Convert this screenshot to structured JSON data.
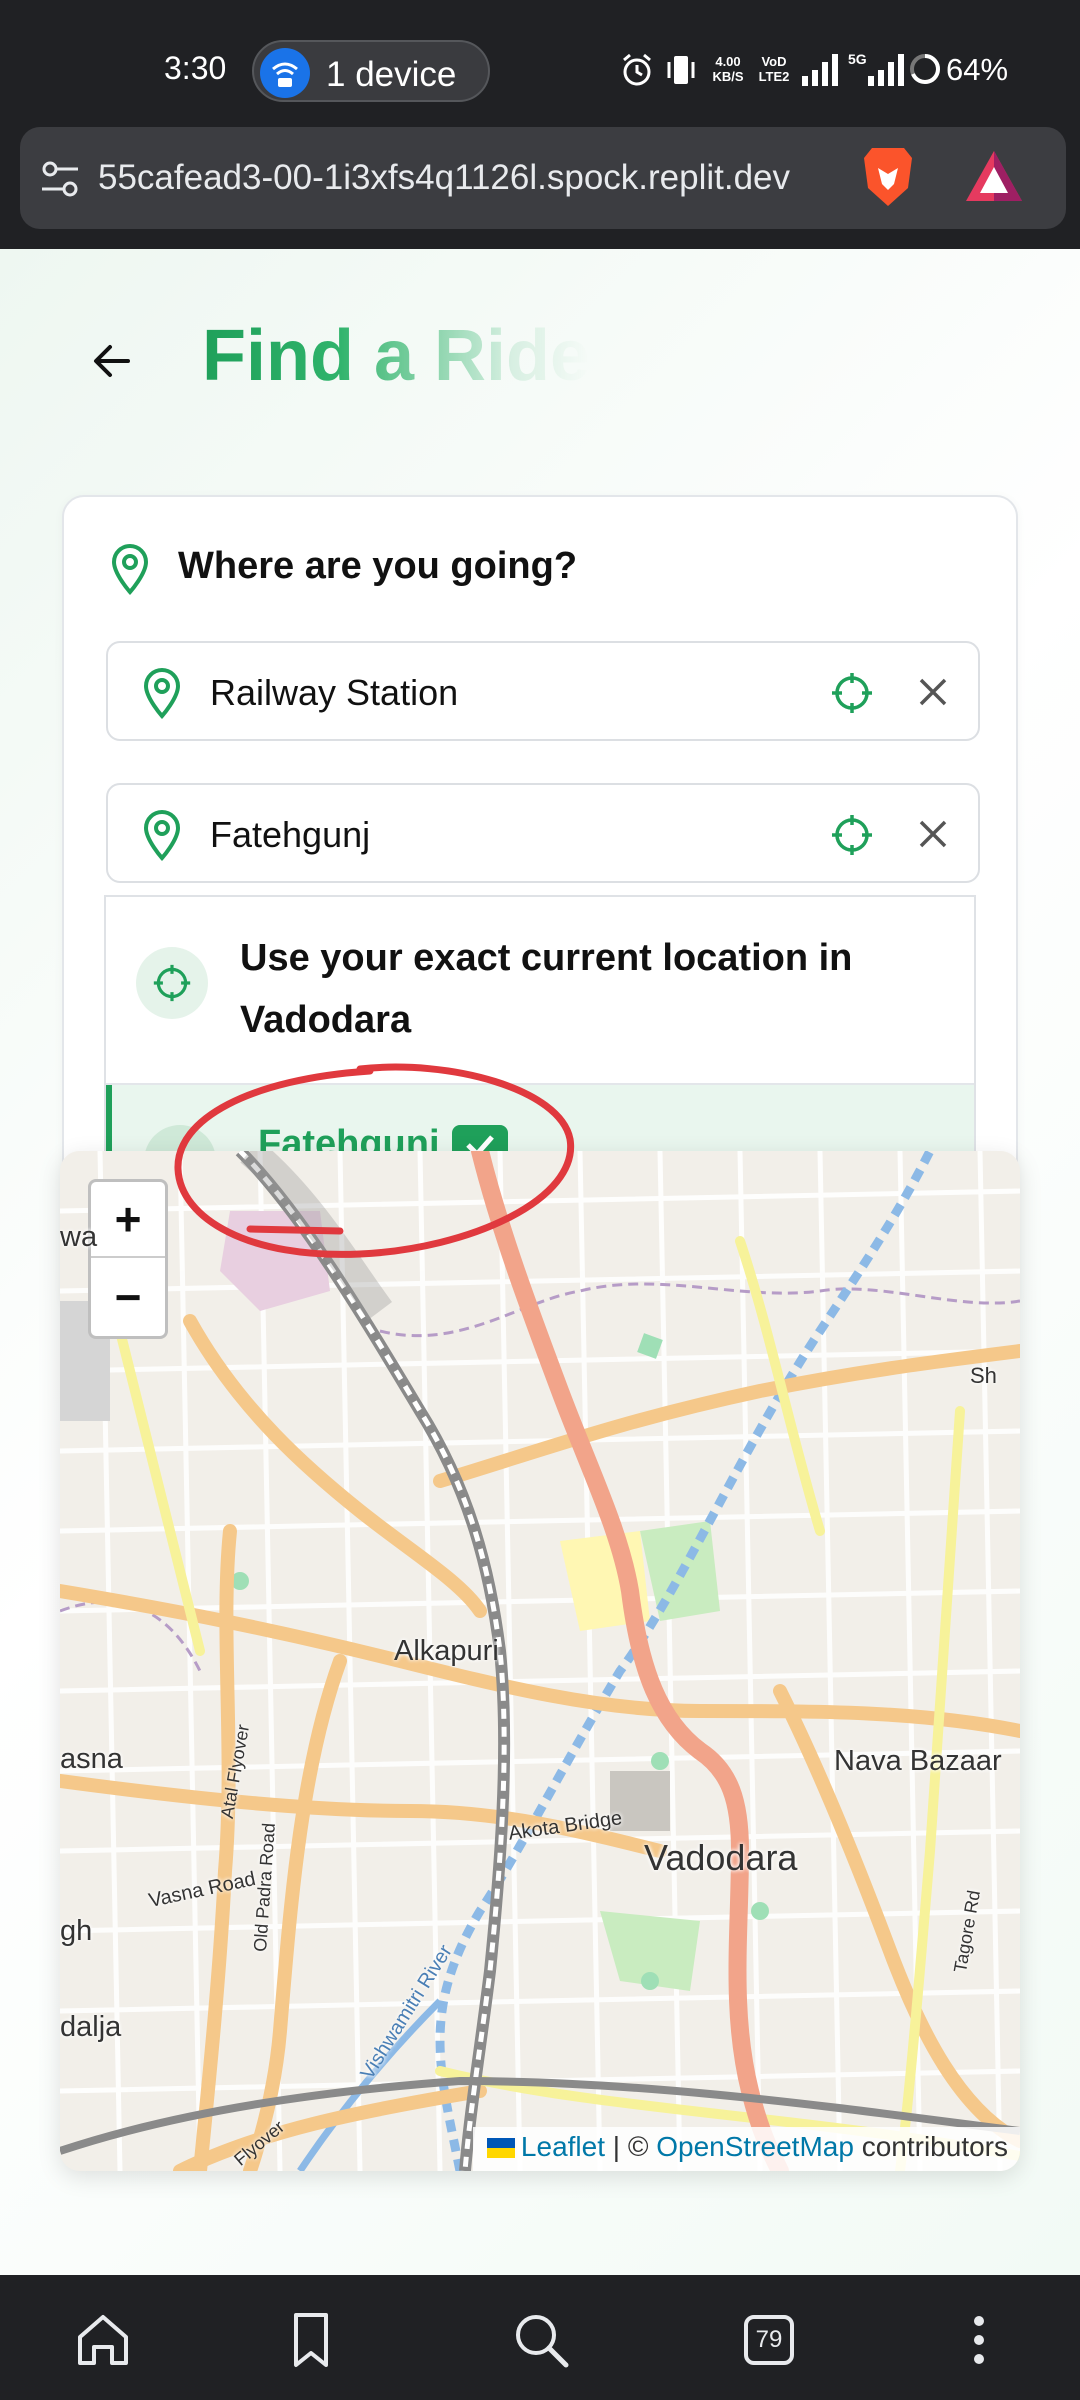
{
  "status_bar": {
    "time": "3:30",
    "cast_label": "1 device",
    "net_speed_value": "4.00",
    "net_speed_unit": "KB/S",
    "volte_top": "VoD",
    "volte_bottom": "LTE2",
    "network_badge": "5G",
    "battery": "64%"
  },
  "browser": {
    "url": "55cafead3-00-1i3xfs4q1126l.spock.replit.dev",
    "tab_count": "79"
  },
  "page": {
    "title": "Find a Ride"
  },
  "search": {
    "heading": "Where are you going?",
    "pickup_value": "Railway Station",
    "destination_value": "Fatehgunj"
  },
  "suggestions": {
    "current_location": "Use your exact current location in Vadodara",
    "match": "Fatehgunj",
    "match_badge": "✓"
  },
  "map": {
    "zoom_in": "+",
    "zoom_out": "−",
    "labels": {
      "alkapuri": "Alkapuri",
      "vadodara": "Vadodara",
      "nava_bazaar": "Nava Bazaar",
      "akota_bridge": "Akota Bridge",
      "vasna_road": "Vasna Road",
      "atal_flyover": "Atal Flyover",
      "old_padra_road": "Old Padra Road",
      "vishwamitri_river": "Vishwamitri River",
      "tagore_rd": "Tagore Rd",
      "edge_wa": "wa",
      "edge_asna": "asna",
      "edge_gh": "gh",
      "edge_dalja": "dalja",
      "edge_sh": "Sh",
      "edge_flyover": "Flyover"
    },
    "attribution": {
      "leaflet": "Leaflet",
      "separator": " | © ",
      "osm": "OpenStreetMap",
      "suffix": " contributors"
    }
  },
  "colors": {
    "brand_green": "#1fa05a",
    "main_road": "#f2a48a",
    "secondary_road": "#f5c88a",
    "river": "#8cb9e6",
    "annotation_red": "#e0393e"
  },
  "icons": {
    "back": "arrow-left-icon",
    "pin": "map-pin-icon",
    "locate": "crosshair-icon",
    "clear": "close-icon",
    "home": "home-icon",
    "bookmark": "bookmark-icon",
    "search": "search-icon",
    "menu": "more-vertical-icon"
  }
}
